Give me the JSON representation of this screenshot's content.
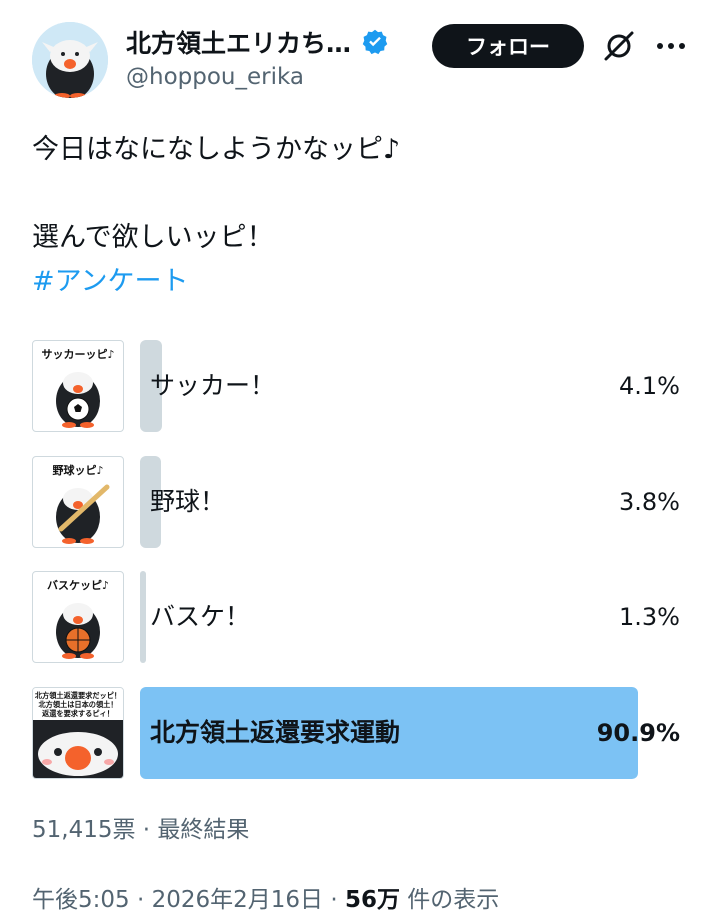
{
  "author": {
    "display_name": "北方領土エリカち…",
    "handle": "@hoppou_erika",
    "verified": true,
    "avatar_icon": "penguin-mascot-avatar"
  },
  "header": {
    "follow_label": "フォロー",
    "grok_icon": "grok-icon",
    "more_icon": "more-options-icon"
  },
  "tweet": {
    "lines": [
      "今日はなになしようかなッピ♪",
      "",
      "選んで欲しいッピ！"
    ],
    "hashtag": "#アンケート"
  },
  "poll": {
    "options": [
      {
        "label": "サッカー！",
        "percent": "4.1%",
        "value": 4.1,
        "image_caption": "サッカーッピ♪",
        "image_icon": "soccer-penguin-sticker"
      },
      {
        "label": "野球！",
        "percent": "3.8%",
        "value": 3.8,
        "image_caption": "野球ッピ♪",
        "image_icon": "baseball-penguin-sticker"
      },
      {
        "label": "バスケ！",
        "percent": "1.3%",
        "value": 1.3,
        "image_caption": "バスケッピ♪",
        "image_icon": "basketball-penguin-sticker"
      },
      {
        "label": "北方領土返還要求運動",
        "percent": "90.9%",
        "value": 90.9,
        "winner": true,
        "image_caption_lines": [
          "北方領土返還要求だッピ！",
          "北方領土は日本の領土！",
          "返還を要求するピィ！"
        ],
        "image_icon": "penguin-face-sticker"
      }
    ],
    "votes": "51,415票",
    "separator": "·",
    "status": "最終結果"
  },
  "meta": {
    "time": "午後5:05",
    "separator1": "·",
    "date": "2026年2月16日",
    "separator2": "·",
    "views_count": "56万",
    "views_label": "件の表示"
  },
  "colors": {
    "accent": "#1d9bf0",
    "winner_bar": "#7cc2f4",
    "loser_bar": "#cfd9de",
    "follow_button": "#0f1419"
  }
}
